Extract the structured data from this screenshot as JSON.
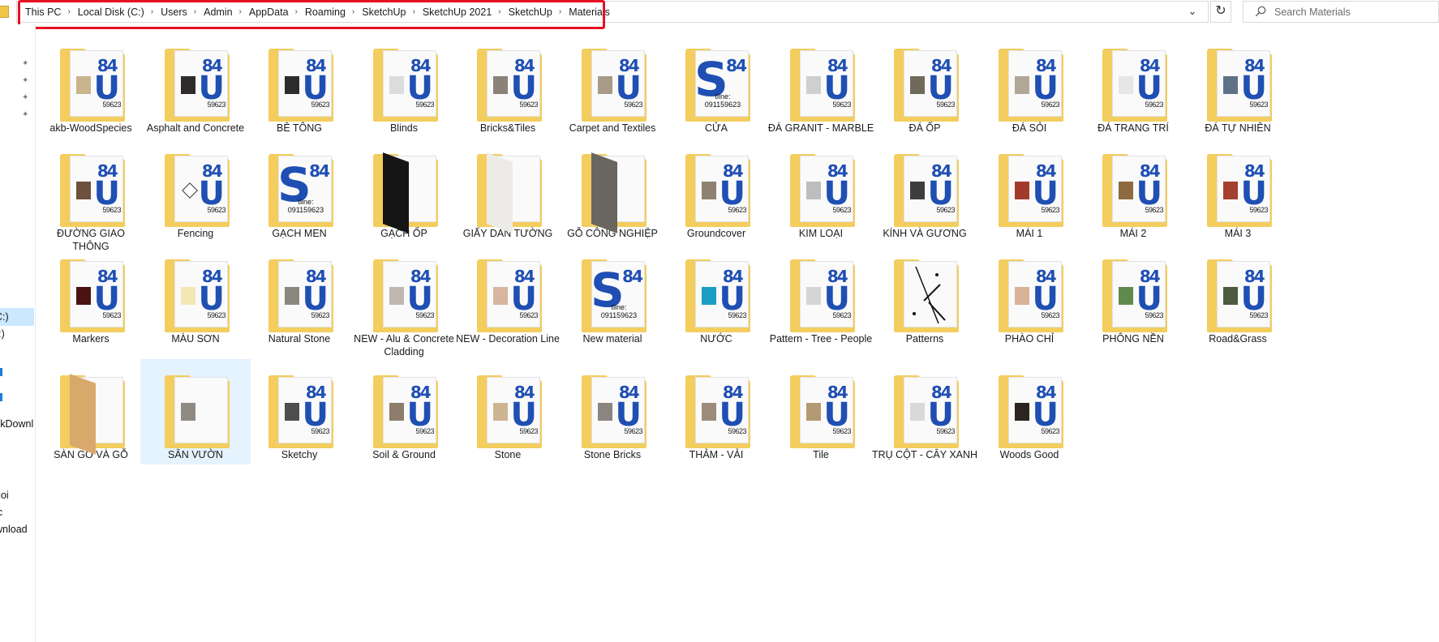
{
  "breadcrumb": [
    "This PC",
    "Local Disk (C:)",
    "Users",
    "Admin",
    "AppData",
    "Roaming",
    "SketchUp",
    "SketchUp 2021",
    "SketchUp",
    "Materials"
  ],
  "search": {
    "placeholder": "Search Materials"
  },
  "nav": {
    "items": [
      {
        "label": "C:)",
        "selected": true
      },
      {
        "label": "):)",
        "selected": false
      },
      {
        "label": "skDownl",
        "selected": false
      },
      {
        "label": "uoi",
        "selected": false
      },
      {
        "label": "ic",
        "selected": false
      },
      {
        "label": "wnload",
        "selected": false
      }
    ]
  },
  "colors": {
    "highlight": "#e81123",
    "folder": "#f3cd5e",
    "selection": "#cce8ff",
    "logo_blue": "#1f4fb3"
  },
  "folders": [
    {
      "name": "akb-WoodSpecies",
      "swatch": "#c9b48d",
      "style": "logo"
    },
    {
      "name": "Asphalt and Concrete",
      "swatch": "#2f2b2a",
      "style": "logo"
    },
    {
      "name": "BÊ TÔNG",
      "swatch": "#2d2b2b",
      "style": "logo"
    },
    {
      "name": "Blinds",
      "swatch": "#dcdcdc",
      "style": "logo"
    },
    {
      "name": "Bricks&Tiles",
      "swatch": "#8c8378",
      "style": "logo"
    },
    {
      "name": "Carpet and Textiles",
      "swatch": "#a99b8a",
      "style": "logo"
    },
    {
      "name": "CỬA",
      "swatch": "",
      "style": "big",
      "caption": "tline: 091159623"
    },
    {
      "name": "ĐÁ GRANIT - MARBLE",
      "swatch": "#cfcfcf",
      "style": "logo"
    },
    {
      "name": "ĐÁ ỐP",
      "swatch": "#6f6a5c",
      "style": "logo"
    },
    {
      "name": "ĐÁ SỎI",
      "swatch": "#b0a797",
      "style": "logo"
    },
    {
      "name": "ĐÁ TRANG TRÍ",
      "swatch": "#e6e6e6",
      "style": "logo"
    },
    {
      "name": "ĐÁ TỰ NHIÊN",
      "swatch": "#5f7285",
      "style": "logo"
    },
    {
      "name": "ĐƯỜNG GIAO THÔNG",
      "swatch": "#6d513c",
      "style": "logo"
    },
    {
      "name": "Fencing",
      "swatch": "#ffffff",
      "style": "logo"
    },
    {
      "name": "GẠCH MEN",
      "swatch": "",
      "style": "big",
      "caption": "tline: 091159623"
    },
    {
      "name": "GẠCH ỐP",
      "swatch": "#151515",
      "style": "spine"
    },
    {
      "name": "GIẤY DÁN TƯỜNG",
      "swatch": "#ecebe8",
      "style": "spine"
    },
    {
      "name": "GỖ CÔNG NGHIỆP",
      "swatch": "#68665f",
      "style": "spine"
    },
    {
      "name": "Groundcover",
      "swatch": "#8f8172",
      "style": "logo"
    },
    {
      "name": "KIM LOẠI",
      "swatch": "#bdbdbd",
      "style": "logo"
    },
    {
      "name": "KÍNH VÀ GƯƠNG",
      "swatch": "#3d3d3d",
      "style": "logo"
    },
    {
      "name": "MÁI 1",
      "swatch": "#a33b2d",
      "style": "logo"
    },
    {
      "name": "MÁI 2",
      "swatch": "#8d6b3f",
      "style": "logo"
    },
    {
      "name": "MÁI 3",
      "swatch": "#a3402f",
      "style": "logo"
    },
    {
      "name": "Markers",
      "swatch": "#4b1414",
      "style": "logo"
    },
    {
      "name": "MÀU SƠN",
      "swatch": "#f5e7b5",
      "style": "logo"
    },
    {
      "name": "Natural Stone",
      "swatch": "#8a877d",
      "style": "logo"
    },
    {
      "name": "NEW - Alu & Concrete Cladding",
      "swatch": "#bfb8ae",
      "style": "logo"
    },
    {
      "name": "NEW - Decoration Line",
      "swatch": "#d6b6a0",
      "style": "logo"
    },
    {
      "name": "New material",
      "swatch": "",
      "style": "big",
      "caption": "tline: 091159623"
    },
    {
      "name": "NƯỚC",
      "swatch": "#1a9ec2",
      "style": "logo"
    },
    {
      "name": "Pattern - Tree - People",
      "swatch": "#d5d5d5",
      "style": "logo"
    },
    {
      "name": "Patterns",
      "swatch": "",
      "style": "patterns"
    },
    {
      "name": "PHÀO CHỈ",
      "swatch": "#d9b197",
      "style": "logo"
    },
    {
      "name": "PHÔNG NỀN",
      "swatch": "#5f8a4b",
      "style": "logo"
    },
    {
      "name": "Road&Grass",
      "swatch": "#4c5a3f",
      "style": "logo"
    },
    {
      "name": "SÀN GỖ VÀ GỖ",
      "swatch": "#d9a96b",
      "style": "spine"
    },
    {
      "name": "SÂN VƯỜN",
      "swatch": "#8f8a83",
      "style": "plain",
      "selected": true
    },
    {
      "name": "Sketchy",
      "swatch": "#4e4e4e",
      "style": "logo"
    },
    {
      "name": "Soil & Ground",
      "swatch": "#8e7d6c",
      "style": "logo"
    },
    {
      "name": "Stone",
      "swatch": "#cdb592",
      "style": "logo"
    },
    {
      "name": "Stone Bricks",
      "swatch": "#8a8581",
      "style": "logo"
    },
    {
      "name": "THẢM - VẢI",
      "swatch": "#9b8b7b",
      "style": "logo"
    },
    {
      "name": "Tile",
      "swatch": "#b49a73",
      "style": "logo"
    },
    {
      "name": "TRỤ CỘT - CÂY XANH",
      "swatch": "#d9d9d9",
      "style": "logo"
    },
    {
      "name": "Woods Good",
      "swatch": "#2b2420",
      "style": "logo"
    }
  ],
  "paper_text": {
    "logo_top": "84",
    "logo_bottom": "U",
    "logo_big": "S",
    "number": "59623"
  }
}
